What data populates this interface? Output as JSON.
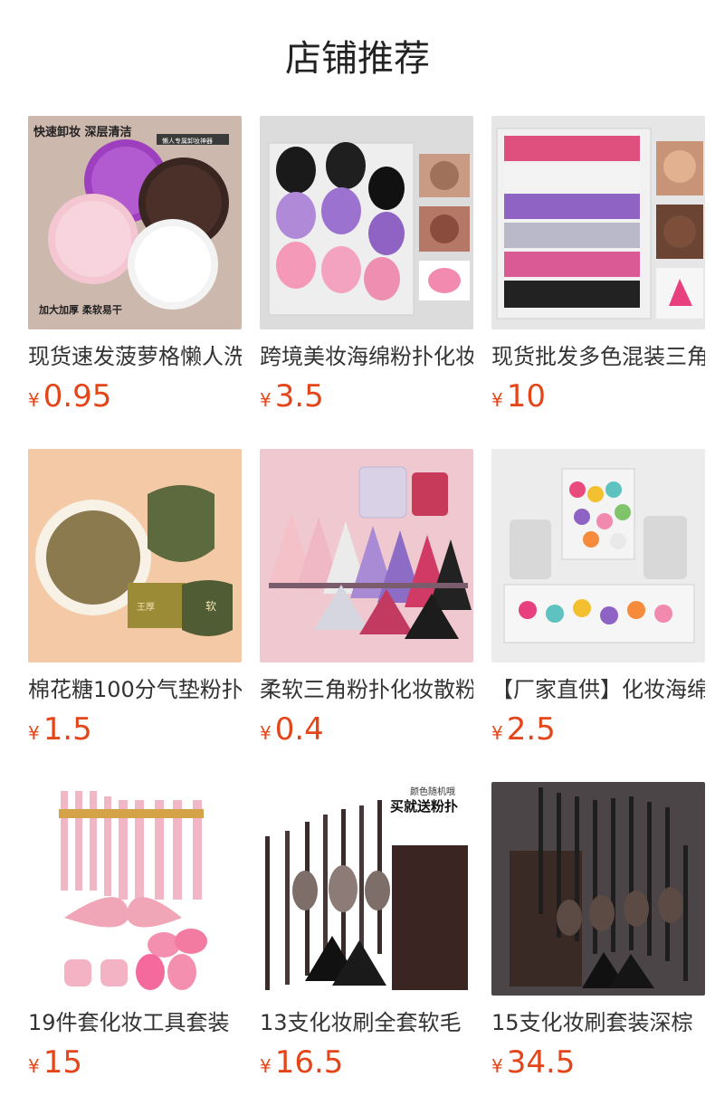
{
  "header": {
    "title": "店铺推荐"
  },
  "colors": {
    "price": "#e4461a",
    "title": "#333333"
  },
  "products": [
    {
      "title": "现货速发菠萝格懒人洗脸扑",
      "currency": "¥",
      "price": "0.95",
      "image_text": {
        "top_left": "快速卸妆   深层清洁",
        "tag": "懒人专属卸妆神器",
        "bottom": "加大加厚 柔软易干"
      }
    },
    {
      "title": "跨境美妆海绵粉扑化妆蛋",
      "currency": "¥",
      "price": "3.5"
    },
    {
      "title": "现货批发多色混装三角粉扑",
      "currency": "¥",
      "price": "10"
    },
    {
      "title": "棉花糖100分气垫粉扑",
      "currency": "¥",
      "price": "1.5",
      "image_text": {
        "tag1": "王厚",
        "tag2": "软"
      }
    },
    {
      "title": "柔软三角粉扑化妆散粉扑",
      "currency": "¥",
      "price": "0.4"
    },
    {
      "title": "【厂家直供】化妆海绵蛋",
      "currency": "¥",
      "price": "2.5"
    },
    {
      "title": "19件套化妆工具套装",
      "currency": "¥",
      "price": "15"
    },
    {
      "title": "13支化妆刷全套软毛",
      "currency": "¥",
      "price": "16.5",
      "image_text": {
        "note": "颜色随机哦",
        "promo": "买就送粉扑"
      }
    },
    {
      "title": "15支化妆刷套装深棕",
      "currency": "¥",
      "price": "34.5"
    }
  ]
}
